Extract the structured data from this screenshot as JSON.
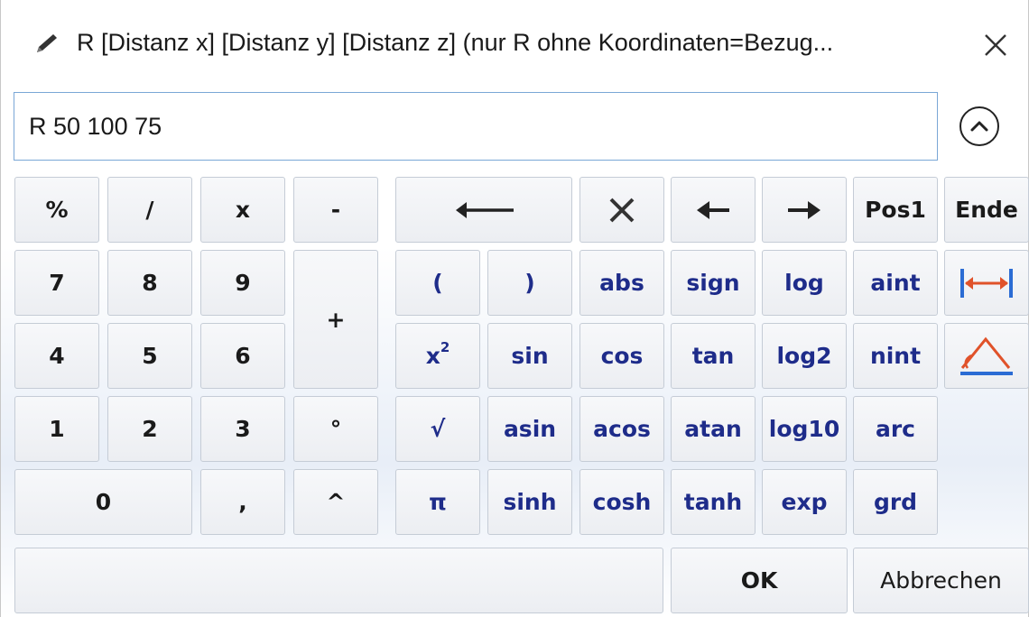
{
  "dialog": {
    "title": "R [Distanz x] [Distanz y] [Distanz z] (nur R ohne Koordinaten=Bezug...",
    "close_symbol": "✕",
    "title_icon": "pencil-icon",
    "expression_value": "R 50 100 75"
  },
  "keys": {
    "percent": "%",
    "divide": "/",
    "multiply": "x",
    "minus": "-",
    "seven": "7",
    "eight": "8",
    "nine": "9",
    "plus": "+",
    "four": "4",
    "five": "5",
    "six": "6",
    "one": "1",
    "two": "2",
    "three": "3",
    "degree": "°",
    "zero": "0",
    "comma": ",",
    "caret": "^",
    "pos1": "Pos1",
    "ende": "Ende",
    "paren_open": "(",
    "paren_close": ")",
    "abs": "abs",
    "sign": "sign",
    "log": "log",
    "aint": "aint",
    "x2_base": "x",
    "x2_exp": "2",
    "sin": "sin",
    "cos": "cos",
    "tan": "tan",
    "log2": "log2",
    "nint": "nint",
    "sqrt": "√",
    "asin": "asin",
    "acos": "acos",
    "atan": "atan",
    "log10": "log10",
    "arc": "arc",
    "pi": "π",
    "sinh": "sinh",
    "cosh": "cosh",
    "tanh": "tanh",
    "exp": "exp",
    "grd": "grd",
    "ok": "OK",
    "cancel": "Abbrechen"
  },
  "icons": {
    "backspace": "long-left-arrow-icon",
    "clear": "x-clear-icon",
    "cursor_left": "left-arrow-icon",
    "cursor_right": "right-arrow-icon",
    "measure_distance": "distance-measure-icon",
    "measure_angle": "angle-measure-icon",
    "collapse": "chevron-up-circle-icon"
  },
  "colors": {
    "function_text": "#1e2c8a",
    "measure_blue": "#2b6cd4",
    "measure_orange": "#e0522a",
    "input_border": "#7aa7d6"
  }
}
